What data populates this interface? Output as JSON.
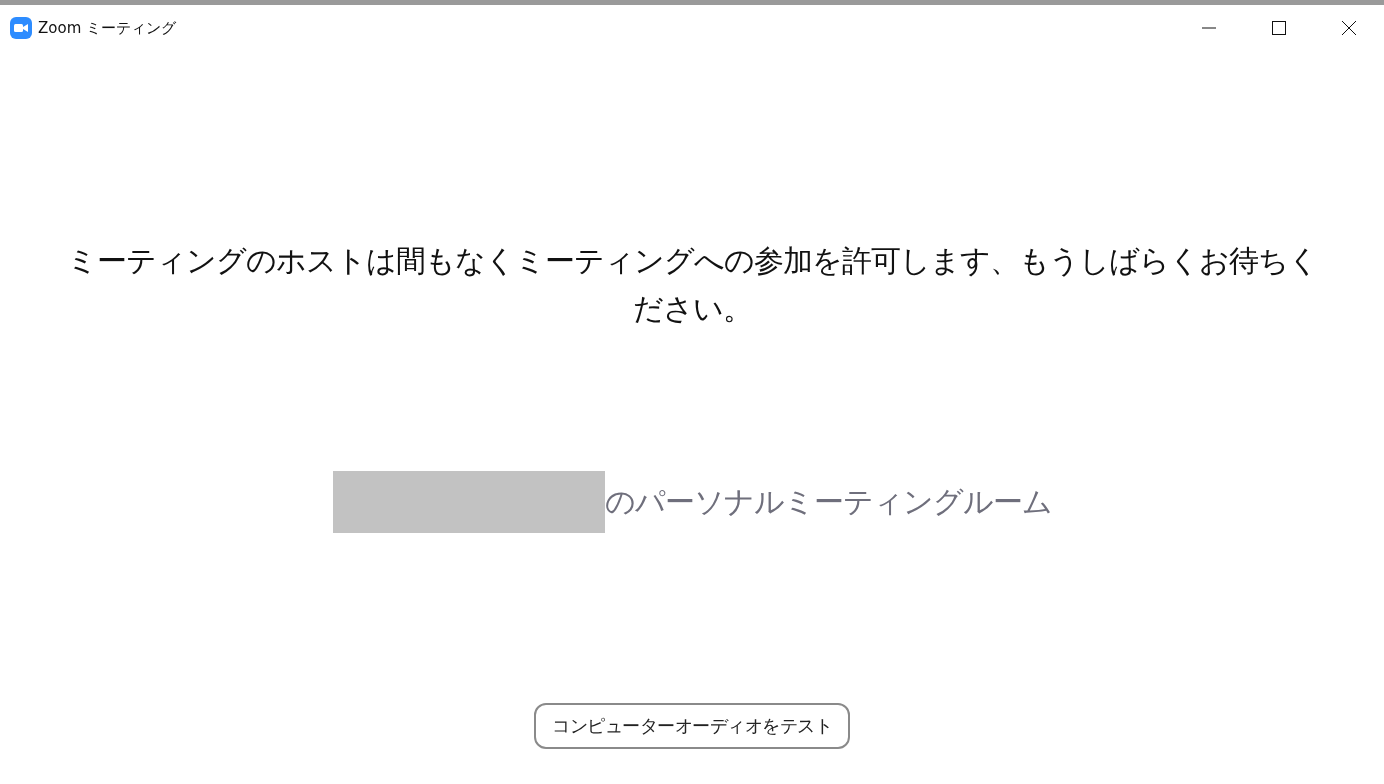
{
  "window": {
    "title": "Zoom ミーティング"
  },
  "message": "ミーティングのホストは間もなくミーティングへの参加を許可します、もうしばらくお待ちください。",
  "room": {
    "name_redacted": true,
    "label": "のパーソナルミーティングルーム"
  },
  "buttons": [
    {
      "label": "コンピューターオーディオをテスト"
    }
  ]
}
